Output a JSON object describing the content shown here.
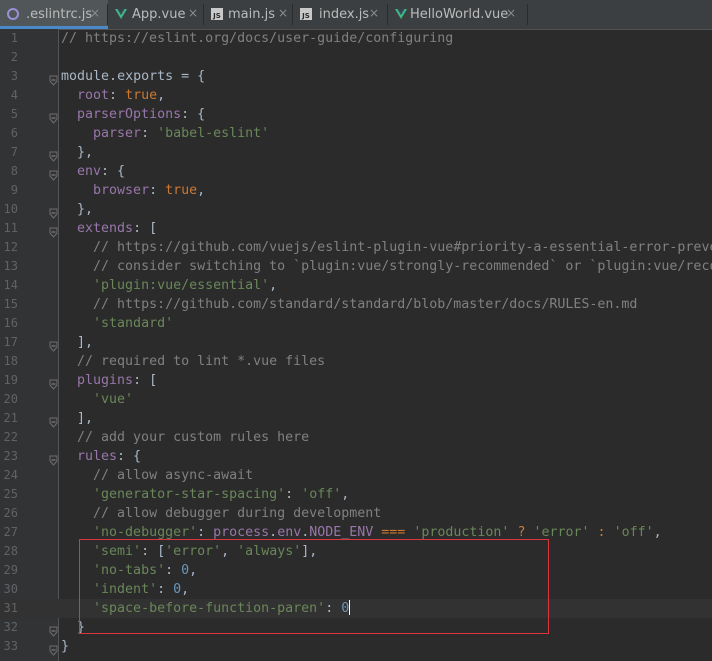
{
  "tabs": [
    {
      "label": ".eslintrc.js",
      "icon": "circle-icon",
      "active": true
    },
    {
      "label": "App.vue",
      "icon": "vue-icon",
      "active": false
    },
    {
      "label": "main.js",
      "icon": "js-icon",
      "active": false
    },
    {
      "label": "index.js",
      "icon": "js-icon",
      "active": false
    },
    {
      "label": "HelloWorld.vue",
      "icon": "vue-icon",
      "active": false
    }
  ],
  "current_line": 31,
  "highlighted_lines": [
    28,
    29,
    30,
    31,
    32
  ],
  "lines": [
    [
      [
        "t-comment",
        "// https://eslint.org/docs/user-guide/configuring"
      ]
    ],
    [],
    [
      [
        "t-ident",
        "module"
      ],
      [
        "t-punc",
        "."
      ],
      [
        "t-ident",
        "exports"
      ],
      [
        "t-punc",
        " = {"
      ]
    ],
    [
      [
        "t-punc",
        "  "
      ],
      [
        "t-key",
        "root"
      ],
      [
        "t-punc",
        ": "
      ],
      [
        "t-kw",
        "true"
      ],
      [
        "t-punc",
        ","
      ]
    ],
    [
      [
        "t-punc",
        "  "
      ],
      [
        "t-key",
        "parserOptions"
      ],
      [
        "t-punc",
        ": {"
      ]
    ],
    [
      [
        "t-punc",
        "    "
      ],
      [
        "t-key",
        "parser"
      ],
      [
        "t-punc",
        ": "
      ],
      [
        "t-str",
        "'babel-eslint'"
      ]
    ],
    [
      [
        "t-punc",
        "  },"
      ]
    ],
    [
      [
        "t-punc",
        "  "
      ],
      [
        "t-key",
        "env"
      ],
      [
        "t-punc",
        ": {"
      ]
    ],
    [
      [
        "t-punc",
        "    "
      ],
      [
        "t-key",
        "browser"
      ],
      [
        "t-punc",
        ": "
      ],
      [
        "t-kw",
        "true"
      ],
      [
        "t-punc",
        ","
      ]
    ],
    [
      [
        "t-punc",
        "  },"
      ]
    ],
    [
      [
        "t-punc",
        "  "
      ],
      [
        "t-key",
        "extends"
      ],
      [
        "t-punc",
        ": ["
      ]
    ],
    [
      [
        "t-punc",
        "    "
      ],
      [
        "t-comment",
        "// https://github.com/vuejs/eslint-plugin-vue#priority-a-essential-error-preve"
      ]
    ],
    [
      [
        "t-punc",
        "    "
      ],
      [
        "t-comment",
        "// consider switching to `plugin:vue/strongly-recommended` or `plugin:vue/reco"
      ]
    ],
    [
      [
        "t-punc",
        "    "
      ],
      [
        "t-str",
        "'plugin:vue/essential'"
      ],
      [
        "t-punc",
        ","
      ]
    ],
    [
      [
        "t-punc",
        "    "
      ],
      [
        "t-comment",
        "// https://github.com/standard/standard/blob/master/docs/RULES-en.md"
      ]
    ],
    [
      [
        "t-punc",
        "    "
      ],
      [
        "t-str",
        "'standard'"
      ]
    ],
    [
      [
        "t-punc",
        "  ],"
      ]
    ],
    [
      [
        "t-punc",
        "  "
      ],
      [
        "t-comment",
        "// required to lint *.vue files"
      ]
    ],
    [
      [
        "t-punc",
        "  "
      ],
      [
        "t-key",
        "plugins"
      ],
      [
        "t-punc",
        ": ["
      ]
    ],
    [
      [
        "t-punc",
        "    "
      ],
      [
        "t-str",
        "'vue'"
      ]
    ],
    [
      [
        "t-punc",
        "  ],"
      ]
    ],
    [
      [
        "t-punc",
        "  "
      ],
      [
        "t-comment",
        "// add your custom rules here"
      ]
    ],
    [
      [
        "t-punc",
        "  "
      ],
      [
        "t-key",
        "rules"
      ],
      [
        "t-punc",
        ": {"
      ]
    ],
    [
      [
        "t-punc",
        "    "
      ],
      [
        "t-comment",
        "// allow async-await"
      ]
    ],
    [
      [
        "t-punc",
        "    "
      ],
      [
        "t-str",
        "'generator-star-spacing'"
      ],
      [
        "t-punc",
        ": "
      ],
      [
        "t-str",
        "'off'"
      ],
      [
        "t-punc",
        ","
      ]
    ],
    [
      [
        "t-punc",
        "    "
      ],
      [
        "t-comment",
        "// allow debugger during development"
      ]
    ],
    [
      [
        "t-punc",
        "    "
      ],
      [
        "t-str",
        "'no-debugger'"
      ],
      [
        "t-punc",
        ": "
      ],
      [
        "t-prop",
        "process"
      ],
      [
        "t-punc",
        "."
      ],
      [
        "t-prop",
        "env"
      ],
      [
        "t-punc",
        "."
      ],
      [
        "t-prop",
        "NODE_ENV"
      ],
      [
        "t-punc",
        " "
      ],
      [
        "t-op",
        "==="
      ],
      [
        "t-punc",
        " "
      ],
      [
        "t-str",
        "'production'"
      ],
      [
        "t-punc",
        " "
      ],
      [
        "t-op",
        "?"
      ],
      [
        "t-punc",
        " "
      ],
      [
        "t-str",
        "'error'"
      ],
      [
        "t-punc",
        " "
      ],
      [
        "t-op",
        ":"
      ],
      [
        "t-punc",
        " "
      ],
      [
        "t-str",
        "'off'"
      ],
      [
        "t-punc",
        ","
      ]
    ],
    [
      [
        "t-punc",
        "    "
      ],
      [
        "t-str",
        "'semi'"
      ],
      [
        "t-punc",
        ": ["
      ],
      [
        "t-str",
        "'error'"
      ],
      [
        "t-punc",
        ", "
      ],
      [
        "t-str",
        "'always'"
      ],
      [
        "t-punc",
        "],"
      ]
    ],
    [
      [
        "t-punc",
        "    "
      ],
      [
        "t-str",
        "'no-tabs'"
      ],
      [
        "t-punc",
        ": "
      ],
      [
        "t-num",
        "0"
      ],
      [
        "t-punc",
        ","
      ]
    ],
    [
      [
        "t-punc",
        "    "
      ],
      [
        "t-str",
        "'indent'"
      ],
      [
        "t-punc",
        ": "
      ],
      [
        "t-num",
        "0"
      ],
      [
        "t-punc",
        ","
      ]
    ],
    [
      [
        "t-punc",
        "    "
      ],
      [
        "t-str",
        "'space-before-function-paren'"
      ],
      [
        "t-punc",
        ": "
      ],
      [
        "t-num",
        "0"
      ],
      [
        "cursor",
        ""
      ]
    ],
    [
      [
        "t-punc",
        "  }"
      ]
    ],
    [
      [
        "t-punc",
        "}"
      ]
    ]
  ],
  "fold_markers": [
    3,
    5,
    7,
    8,
    10,
    11,
    17,
    19,
    21,
    23,
    32,
    33
  ]
}
